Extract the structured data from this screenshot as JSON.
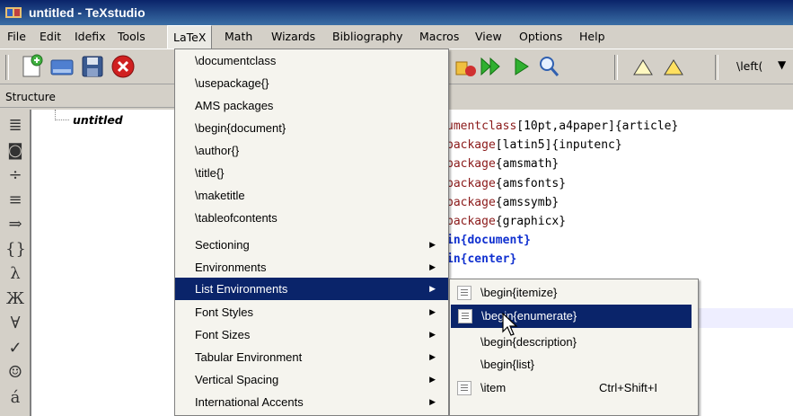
{
  "window": {
    "title": "untitled - TeXstudio"
  },
  "menubar": [
    "File",
    "Edit",
    "Idefix",
    "Tools",
    "LaTeX",
    "Math",
    "Wizards",
    "Bibliography",
    "Macros",
    "View",
    "Options",
    "Help"
  ],
  "toolbar": {
    "left_paren": "\\left("
  },
  "structure": {
    "label": "Structure",
    "root": "untitled"
  },
  "side_icons": [
    "list-icon",
    "bookmark-icon",
    "divide-icon",
    "equiv-icon",
    "implies-icon",
    "braces-icon",
    "lambda-icon",
    "cyrillic-icon",
    "forall-icon",
    "check-icon",
    "smiley-icon",
    "accent-icon"
  ],
  "side_glyphs": [
    "≣",
    "◙",
    "÷",
    "≡",
    "⇒",
    "{}",
    "λ",
    "Ж",
    "∀",
    "✓",
    "☺",
    "á"
  ],
  "editor": {
    "lines": [
      [
        {
          "c": "kw",
          "t": "umentclass"
        },
        {
          "c": "txt",
          "t": "[10pt,a4paper]{article}"
        }
      ],
      [
        {
          "c": "kw",
          "t": "package"
        },
        {
          "c": "txt",
          "t": "[latin5]{inputenc}"
        }
      ],
      [
        {
          "c": "kw",
          "t": "package"
        },
        {
          "c": "txt",
          "t": "{amsmath}"
        }
      ],
      [
        {
          "c": "kw",
          "t": "package"
        },
        {
          "c": "txt",
          "t": "{amsfonts}"
        }
      ],
      [
        {
          "c": "kw",
          "t": "package"
        },
        {
          "c": "txt",
          "t": "{amssymb}"
        }
      ],
      [
        {
          "c": "kw",
          "t": "package"
        },
        {
          "c": "txt",
          "t": "{graphicx}"
        }
      ],
      [
        {
          "c": "bl",
          "t": "in{document}"
        }
      ],
      [
        {
          "c": "bl",
          "t": "in{center}"
        }
      ]
    ]
  },
  "latex_menu": {
    "items": [
      {
        "label": "\\documentclass",
        "submenu": false
      },
      {
        "label": "\\usepackage{}",
        "submenu": false
      },
      {
        "label": "AMS packages",
        "submenu": false
      },
      {
        "label": "\\begin{document}",
        "submenu": false
      },
      {
        "label": "\\author{}",
        "submenu": false
      },
      {
        "label": "\\title{}",
        "submenu": false
      },
      {
        "label": "\\maketitle",
        "submenu": false
      },
      {
        "label": "\\tableofcontents",
        "submenu": false
      },
      {
        "label": "Sectioning",
        "submenu": true
      },
      {
        "label": "Environments",
        "submenu": true
      },
      {
        "label": "List Environments",
        "submenu": true,
        "highlight": true
      },
      {
        "label": "Font Styles",
        "submenu": true
      },
      {
        "label": "Font Sizes",
        "submenu": true
      },
      {
        "label": "Tabular Environment",
        "submenu": true
      },
      {
        "label": "Vertical Spacing",
        "submenu": true
      },
      {
        "label": "International Accents",
        "submenu": true
      }
    ]
  },
  "list_submenu": {
    "items": [
      {
        "label": "\\begin{itemize}",
        "icon": true,
        "shortcut": ""
      },
      {
        "label": "\\begin{enumerate}",
        "icon": true,
        "shortcut": "",
        "highlight": true
      },
      {
        "label": "\\begin{description}",
        "icon": false,
        "shortcut": ""
      },
      {
        "label": "\\begin{list}",
        "icon": false,
        "shortcut": ""
      },
      {
        "label": "\\item",
        "icon": true,
        "shortcut": "Ctrl+Shift+I"
      }
    ]
  }
}
